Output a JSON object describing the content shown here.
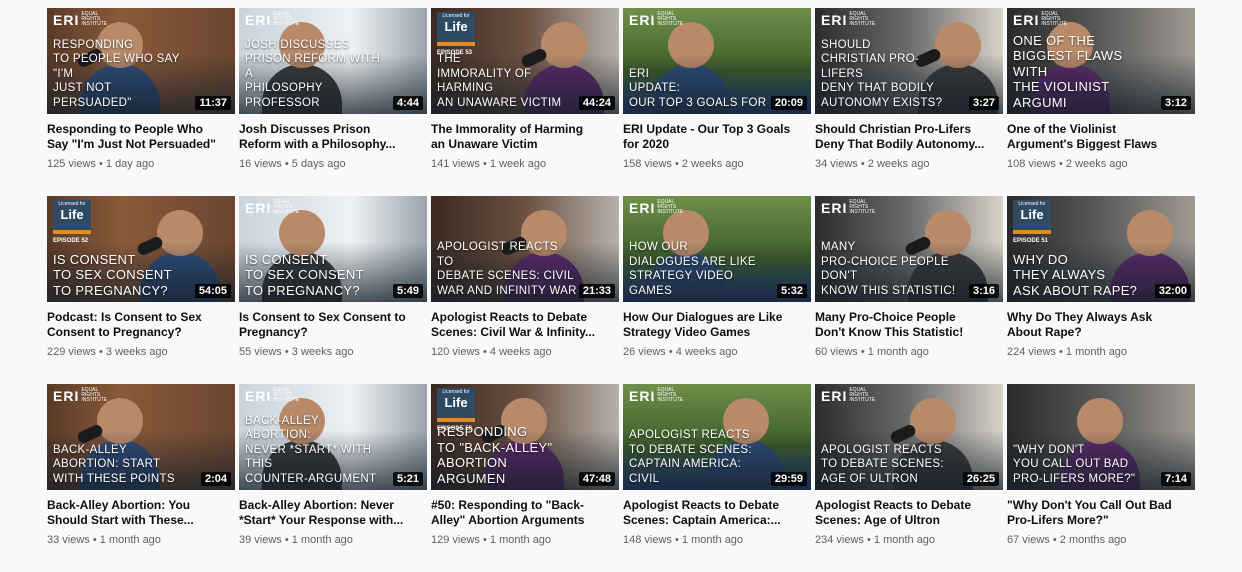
{
  "videos": [
    {
      "overlay": "Responding\nto people who say \"I'm\njust not persuaded\"",
      "duration": "11:37",
      "title": "Responding to People Who\nSay \"I'm Just Not Persuaded\"",
      "views": "125 views",
      "age": "1 day ago",
      "badge": "eri"
    },
    {
      "overlay": "Josh discusses\nprison reform with a\nphilosophy professor",
      "duration": "4:44",
      "title": "Josh Discusses Prison\nReform with a Philosophy...",
      "views": "16 views",
      "age": "5 days ago",
      "badge": "eri"
    },
    {
      "overlay": "The\nimmorality of harming\nan unaware victim",
      "duration": "44:24",
      "title": "The Immorality of Harming\nan Unaware Victim",
      "views": "141 views",
      "age": "1 week ago",
      "badge": "life",
      "episode": "EPISODE 53"
    },
    {
      "overlay": "ERI\nUpdate:\nOur top 3 goals for",
      "duration": "20:09",
      "title": "ERI Update - Our Top 3 Goals\nfor 2020",
      "views": "158 views",
      "age": "2 weeks ago",
      "badge": "eri"
    },
    {
      "overlay": "Should\nchristian pro-lifers\ndeny that bodily\nautonomy exists?",
      "duration": "3:27",
      "title": "Should Christian Pro-Lifers\nDeny That Bodily Autonomy...",
      "views": "34 views",
      "age": "2 weeks ago",
      "badge": "eri"
    },
    {
      "overlay": "One of the\nbiggest flaws with\nthe violinist argumi",
      "duration": "3:12",
      "title": "One of the Violinist\nArgument's Biggest Flaws",
      "views": "108 views",
      "age": "2 weeks ago",
      "badge": "eri",
      "big": true
    },
    {
      "overlay": "Is consent\nto sex consent\nto pregnancy?",
      "duration": "54:05",
      "title": "Podcast: Is Consent to Sex\nConsent to Pregnancy?",
      "views": "229 views",
      "age": "3 weeks ago",
      "badge": "life",
      "episode": "EPISODE 52",
      "big": true
    },
    {
      "overlay": "Is consent\nto sex consent\nto pregnancy?",
      "duration": "5:49",
      "title": "Is Consent to Sex Consent to\nPregnancy?",
      "views": "55 views",
      "age": "3 weeks ago",
      "badge": "eri",
      "big": true
    },
    {
      "overlay": "Apologist reacts to\ndebate scenes: civil\nwar and infinity war",
      "duration": "21:33",
      "title": "Apologist Reacts to Debate\nScenes: Civil War & Infinity...",
      "views": "120 views",
      "age": "4 weeks ago",
      "badge": "none"
    },
    {
      "overlay": "How our\ndialogues are like\nstrategy video games",
      "duration": "5:32",
      "title": "How Our Dialogues are Like\nStrategy Video Games",
      "views": "26 views",
      "age": "4 weeks ago",
      "badge": "eri"
    },
    {
      "overlay": "Many\npro-choice people don't\nknow this statistic!",
      "duration": "3:16",
      "title": "Many Pro-Choice People\nDon't Know This Statistic!",
      "views": "60 views",
      "age": "1 month ago",
      "badge": "eri"
    },
    {
      "overlay": "Why do\nthey always\nask about rape?",
      "duration": "32:00",
      "title": "Why Do They Always Ask\nAbout Rape?",
      "views": "224 views",
      "age": "1 month ago",
      "badge": "life",
      "episode": "EPISODE 51",
      "big": true
    },
    {
      "overlay": "Back-alley\nabortion: start\nwith these points",
      "duration": "2:04",
      "title": "Back-Alley Abortion: You\nShould Start with These...",
      "views": "33 views",
      "age": "1 month ago",
      "badge": "eri"
    },
    {
      "overlay": "Back-alley abortion:\nnever *start* with this\ncounter-argument",
      "duration": "5:21",
      "title": "Back-Alley Abortion: Never\n*Start* Your Response with...",
      "views": "39 views",
      "age": "1 month ago",
      "badge": "eri"
    },
    {
      "overlay": "Responding\nto \"back-alley\"\nabortion argumen",
      "duration": "47:48",
      "title": "#50: Responding to \"Back-\nAlley\" Abortion Arguments",
      "views": "129 views",
      "age": "1 month ago",
      "badge": "life",
      "episode": "EPISODE 50",
      "big": true
    },
    {
      "overlay": "Apologist reacts\nto debate scenes:\ncaptain america: civil",
      "duration": "29:59",
      "title": "Apologist Reacts to Debate\nScenes: Captain America:...",
      "views": "148 views",
      "age": "1 month ago",
      "badge": "eri"
    },
    {
      "overlay": "Apologist reacts\nto debate scenes:\nage of ultron",
      "duration": "26:25",
      "title": "Apologist Reacts to Debate\nScenes: Age of Ultron",
      "views": "234 views",
      "age": "1 month ago",
      "badge": "eri"
    },
    {
      "overlay": "\"Why don't\nyou call out bad\npro-lifers more?\"",
      "duration": "7:14",
      "title": "\"Why Don't You Call Out Bad\nPro-Lifers More?\"",
      "views": "67 views",
      "age": "2 months ago",
      "badge": "none"
    }
  ],
  "brand": {
    "logo": "ERI",
    "logo_sub": "EQUAL RIGHTS INSTITUTE",
    "life_top": "Licensed for",
    "life": "Life"
  },
  "colors": {
    "accent_orange": "#e38a28",
    "badge_blue": "#2f4a63"
  }
}
